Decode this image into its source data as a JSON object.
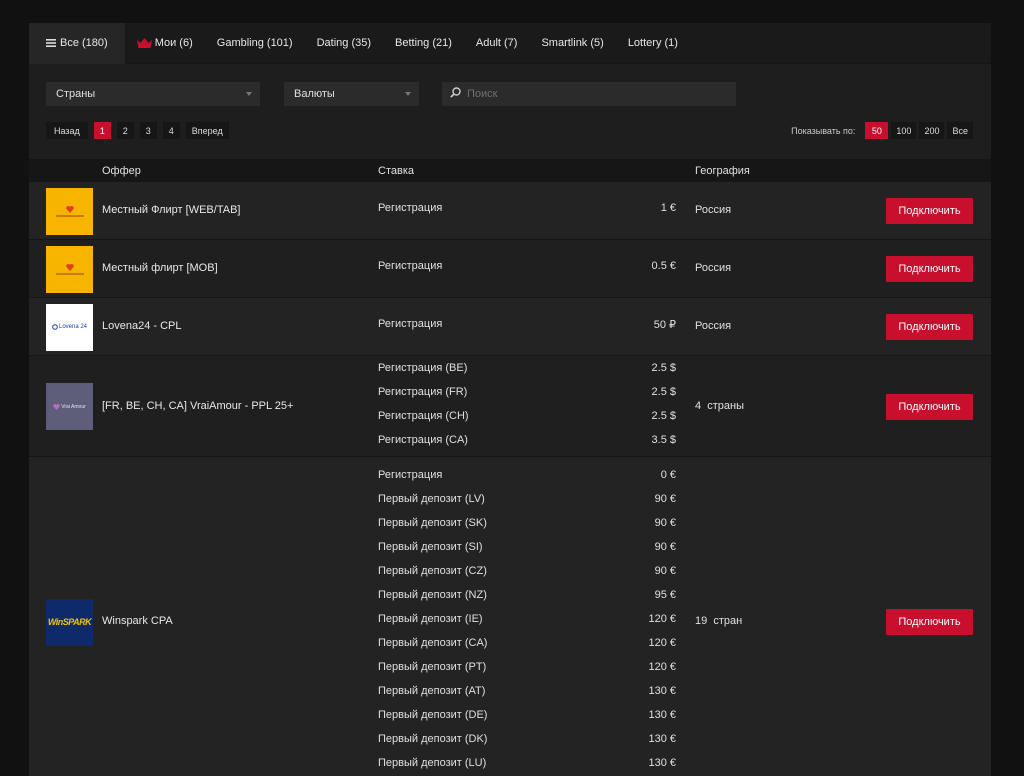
{
  "tabs": [
    {
      "label": "Все (180)",
      "icon": "menu-icon"
    },
    {
      "label": "Мои (6)",
      "icon": "crown-icon"
    },
    {
      "label": "Gambling (101)"
    },
    {
      "label": "Dating (35)"
    },
    {
      "label": "Betting (21)"
    },
    {
      "label": "Adult (7)"
    },
    {
      "label": "Smartlink (5)"
    },
    {
      "label": "Lottery (1)"
    }
  ],
  "filters": {
    "countries_label": "Страны",
    "currencies_label": "Валюты",
    "search_placeholder": "Поиск"
  },
  "pagination": {
    "prev": "Назад",
    "pages": [
      "1",
      "2",
      "3",
      "4"
    ],
    "current": "1",
    "next": "Вперед"
  },
  "per_page": {
    "label": "Показывать по:",
    "options": [
      "50",
      "100",
      "200",
      "Все"
    ],
    "selected": "50"
  },
  "table": {
    "headers": {
      "offer": "Оффер",
      "rate": "Ставка",
      "geo": "География"
    },
    "connect_label": "Подключить",
    "rows": [
      {
        "name": "Местный Флирт [WEB/TAB]",
        "logo": "mestny-flirt-logo",
        "rates": [
          {
            "label": "Регистрация",
            "value": "1 €"
          }
        ],
        "geo": "Россия"
      },
      {
        "name": "Местный флирт [MOB]",
        "logo": "mestny-flirt-logo",
        "rates": [
          {
            "label": "Регистрация",
            "value": "0.5 €"
          }
        ],
        "geo": "Россия"
      },
      {
        "name": "Lovena24 - CPL",
        "logo": "lovena24-logo",
        "logo_text": "Lovena 24",
        "rates": [
          {
            "label": "Регистрация",
            "value": "50 ₽"
          }
        ],
        "geo": "Россия"
      },
      {
        "name": "[FR, BE, CH, CA] VraiAmour - PPL 25+",
        "logo": "vraiamour-logo",
        "logo_text": "Vrai Amour",
        "rates": [
          {
            "label": "Регистрация (BE)",
            "value": "2.5 $"
          },
          {
            "label": "Регистрация (FR)",
            "value": "2.5 $"
          },
          {
            "label": "Регистрация (CH)",
            "value": "2.5 $"
          },
          {
            "label": "Регистрация (CA)",
            "value": "3.5 $"
          }
        ],
        "geo": "4  страны"
      },
      {
        "name": "Winspark CPA",
        "logo": "winspark-logo",
        "logo_text": "WinSPARK",
        "rates": [
          {
            "label": "Регистрация",
            "value": "0 €"
          },
          {
            "label": "Первый депозит (LV)",
            "value": "90 €"
          },
          {
            "label": "Первый депозит (SK)",
            "value": "90 €"
          },
          {
            "label": "Первый депозит (SI)",
            "value": "90 €"
          },
          {
            "label": "Первый депозит (CZ)",
            "value": "90 €"
          },
          {
            "label": "Первый депозит (NZ)",
            "value": "95 €"
          },
          {
            "label": "Первый депозит (IE)",
            "value": "120 €"
          },
          {
            "label": "Первый депозит (CA)",
            "value": "120 €"
          },
          {
            "label": "Первый депозит (PT)",
            "value": "120 €"
          },
          {
            "label": "Первый депозит (AT)",
            "value": "130 €"
          },
          {
            "label": "Первый депозит (DE)",
            "value": "130 €"
          },
          {
            "label": "Первый депозит (DK)",
            "value": "130 €"
          },
          {
            "label": "Первый депозит (LU)",
            "value": "130 €"
          }
        ],
        "geo": "19  стран"
      }
    ]
  },
  "colors": {
    "accent": "#c8102e",
    "panel": "#1e1e1e",
    "background": "#111111"
  }
}
